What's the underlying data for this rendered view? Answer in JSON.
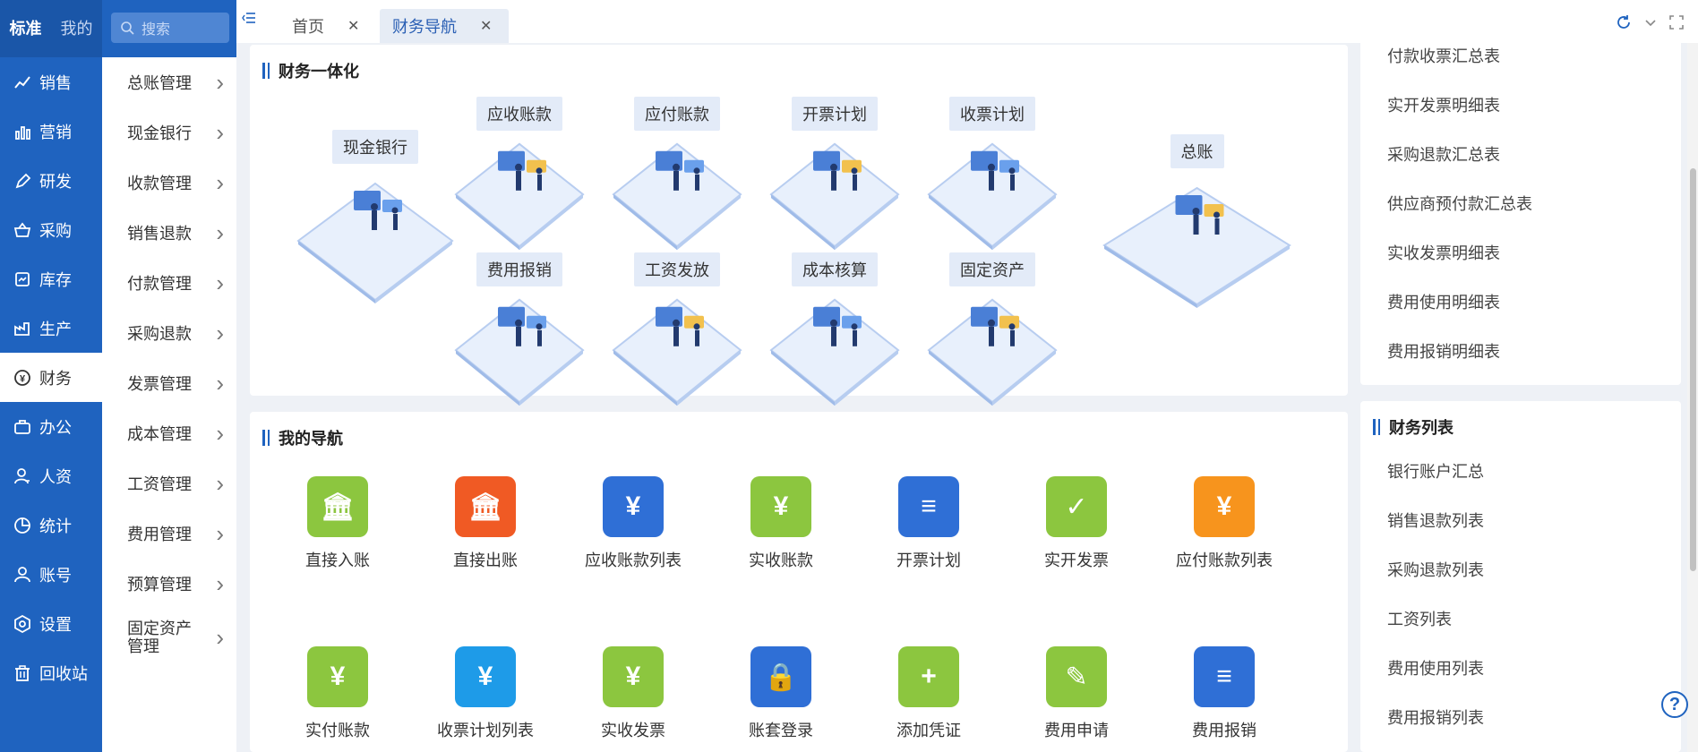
{
  "top_switch": {
    "standard": "标准",
    "mine": "我的"
  },
  "search": {
    "placeholder": "搜索"
  },
  "left_nav": [
    {
      "label": "销售",
      "icon": "chart-icon"
    },
    {
      "label": "营销",
      "icon": "bar-chart-icon"
    },
    {
      "label": "研发",
      "icon": "pen-icon"
    },
    {
      "label": "采购",
      "icon": "basket-icon"
    },
    {
      "label": "库存",
      "icon": "inventory-icon"
    },
    {
      "label": "生产",
      "icon": "factory-icon"
    },
    {
      "label": "财务",
      "icon": "yuan-icon"
    },
    {
      "label": "办公",
      "icon": "briefcase-icon"
    },
    {
      "label": "人资",
      "icon": "person-icon"
    },
    {
      "label": "统计",
      "icon": "pie-icon"
    },
    {
      "label": "账号",
      "icon": "user-icon"
    },
    {
      "label": "设置",
      "icon": "settings-icon"
    },
    {
      "label": "回收站",
      "icon": "trash-icon"
    }
  ],
  "submenu": [
    "总账管理",
    "现金银行",
    "收款管理",
    "销售退款",
    "付款管理",
    "采购退款",
    "发票管理",
    "成本管理",
    "工资管理",
    "费用管理",
    "预算管理",
    "固定资产管理"
  ],
  "tabs": {
    "home": "首页",
    "active": "财务导航"
  },
  "finance_integration": {
    "title": "财务一体化",
    "tiles": [
      "现金银行",
      "应收账款",
      "应付账款",
      "开票计划",
      "收票计划",
      "总账",
      "费用报销",
      "工资发放",
      "成本核算",
      "固定资产"
    ]
  },
  "my_nav": {
    "title": "我的导航",
    "items": [
      {
        "label": "直接入账",
        "color": "#8cc63f"
      },
      {
        "label": "直接出账",
        "color": "#f05a24"
      },
      {
        "label": "应收账款列表",
        "color": "#2f6fd6"
      },
      {
        "label": "实收账款",
        "color": "#8cc63f"
      },
      {
        "label": "开票计划",
        "color": "#2f6fd6"
      },
      {
        "label": "实开发票",
        "color": "#8cc63f"
      },
      {
        "label": "应付账款列表",
        "color": "#f7941d"
      },
      {
        "label": "实付账款",
        "color": "#8cc63f"
      },
      {
        "label": "收票计划列表",
        "color": "#1e9be8"
      },
      {
        "label": "实收发票",
        "color": "#8cc63f"
      },
      {
        "label": "账套登录",
        "color": "#2f6fd6"
      },
      {
        "label": "添加凭证",
        "color": "#8cc63f"
      },
      {
        "label": "费用申请",
        "color": "#8cc63f"
      },
      {
        "label": "费用报销",
        "color": "#2f6fd6"
      }
    ]
  },
  "right_reports": [
    "付款收票汇总表",
    "实开发票明细表",
    "采购退款汇总表",
    "供应商预付款汇总表",
    "实收发票明细表",
    "费用使用明细表",
    "费用报销明细表"
  ],
  "finance_list": {
    "title": "财务列表",
    "items": [
      "银行账户汇总",
      "销售退款列表",
      "采购退款列表",
      "工资列表",
      "费用使用列表",
      "费用报销列表"
    ]
  },
  "help": "?"
}
